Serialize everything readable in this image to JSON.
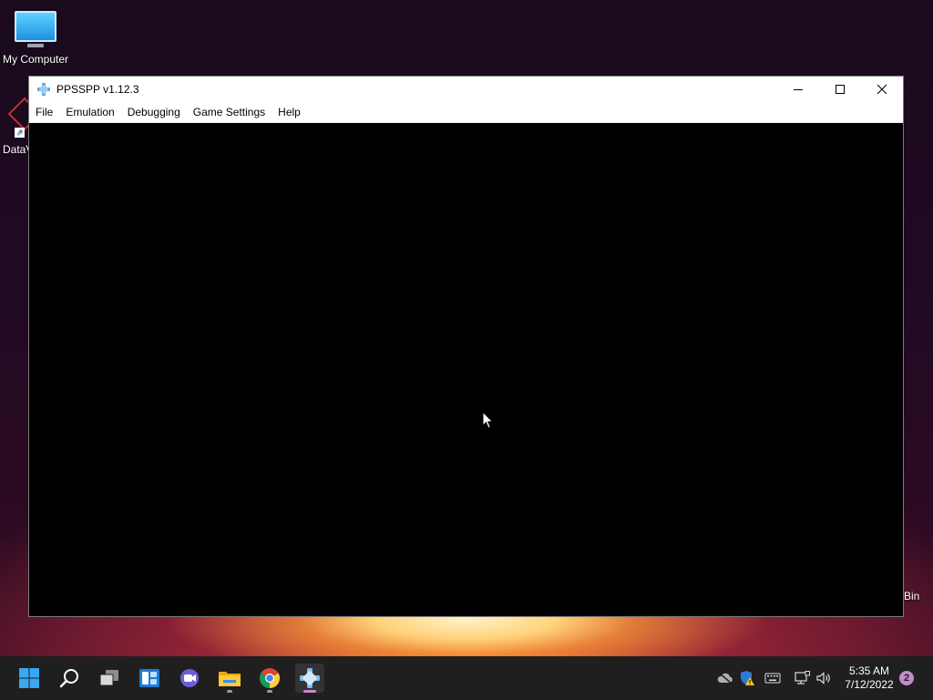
{
  "desktop": {
    "icons": [
      {
        "label": "My Computer",
        "icon": "monitor-icon"
      },
      {
        "label": "DataV",
        "icon": "datav-icon"
      }
    ],
    "recycle_bin_partial_label": "Bin"
  },
  "window": {
    "title": "PPSSPP v1.12.3",
    "icon": "ppsspp-icon",
    "controls": {
      "minimize": "minimize-icon",
      "maximize": "maximize-icon",
      "close": "close-icon"
    },
    "menu": [
      "File",
      "Emulation",
      "Debugging",
      "Game Settings",
      "Help"
    ]
  },
  "taskbar": {
    "apps": [
      {
        "name": "start",
        "icon": "windows-start-icon"
      },
      {
        "name": "search",
        "icon": "search-icon"
      },
      {
        "name": "task-view",
        "icon": "task-view-icon"
      },
      {
        "name": "widgets",
        "icon": "widgets-icon"
      },
      {
        "name": "teams-chat",
        "icon": "chat-icon"
      },
      {
        "name": "file-explorer",
        "icon": "folder-icon"
      },
      {
        "name": "chrome",
        "icon": "chrome-icon"
      },
      {
        "name": "ppsspp",
        "icon": "ppsspp-icon"
      }
    ],
    "tray": [
      "cloud-off-icon",
      "security-warning-icon",
      "keyboard-icon",
      "network-icon",
      "volume-icon"
    ],
    "time": "5:35 AM",
    "date": "7/12/2022",
    "notification_count": "2"
  },
  "colors": {
    "taskbar_bg": "#1f1f1f",
    "accent": "#c58ac9",
    "window_bg": "#000000"
  }
}
